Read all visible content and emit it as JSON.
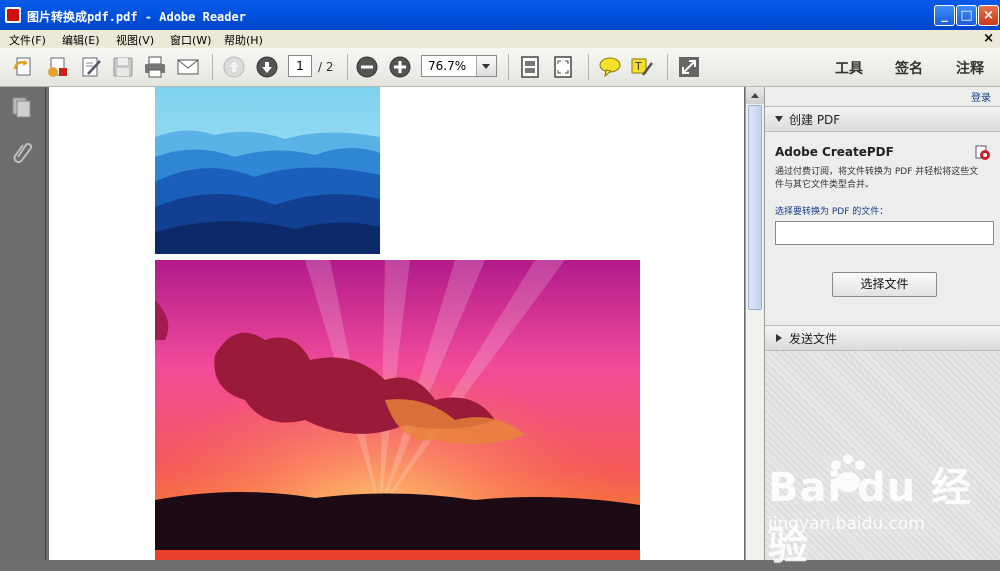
{
  "window": {
    "title": "图片转换成pdf.pdf - Adobe Reader",
    "minimize": "_",
    "maximize": "□",
    "close": "×"
  },
  "menu": {
    "items": [
      "文件(F)",
      "编辑(E)",
      "视图(V)",
      "窗口(W)",
      "帮助(H)"
    ],
    "doc_close": "×"
  },
  "toolbar": {
    "icons": [
      "create-pdf-icon",
      "convert-icon",
      "edit-icon",
      "save-icon",
      "print-icon",
      "email-icon",
      "prev-page-icon",
      "next-page-icon",
      "zoom-out-icon",
      "zoom-in-icon",
      "fit-page-icon",
      "fit-width-icon",
      "comment-icon",
      "highlight-icon",
      "fullscreen-icon"
    ],
    "page_current": "1",
    "page_total": "/ 2",
    "zoom": "76.7%",
    "right_tools": [
      "工具",
      "签名",
      "注释"
    ]
  },
  "left_panel": {
    "icons": [
      "pages-icon",
      "attachment-icon"
    ]
  },
  "right_panel": {
    "login": "登录",
    "create_pdf": {
      "header": "创建 PDF",
      "title": "Adobe CreatePDF",
      "description": "通过付费订阅，将文件转换为 PDF 并轻松将这些文件与其它文件类型合并。",
      "label": "选择要转换为 PDF 的文件：",
      "input_value": "",
      "button": "选择文件"
    },
    "send_file": {
      "header": "发送文件"
    }
  },
  "watermark": {
    "brand": "Bai  du 经验",
    "url": "jingyan.baidu.com"
  },
  "colors": {
    "titlebar": "#0053e0",
    "menubar": "#ece9d8",
    "panel_gray": "#6d6d6d"
  }
}
